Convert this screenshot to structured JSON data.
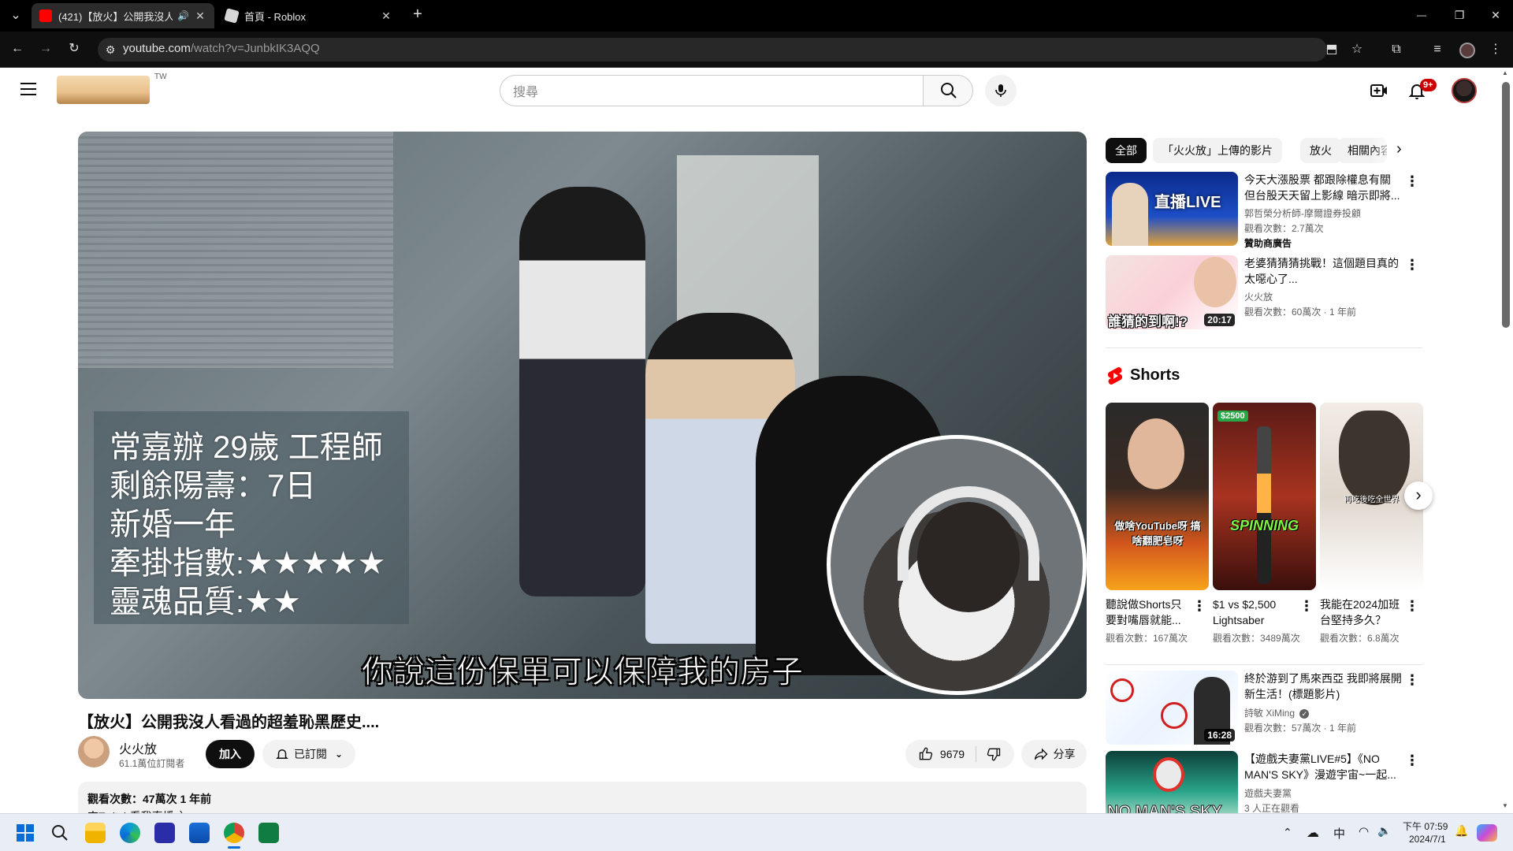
{
  "browser": {
    "tabs": [
      {
        "title": "(421)【放火】公開我沒人看過的超羞恥黑歷史....",
        "active": true
      },
      {
        "title": "首頁 - Roblox",
        "active": false
      }
    ],
    "new_tab": "+",
    "url_host": "youtube.com",
    "url_path": "/watch?v=JunbkIK3AQQ",
    "window_controls": [
      "—",
      "❐",
      "✕"
    ]
  },
  "yt": {
    "region": "TW",
    "search_placeholder": "搜尋",
    "notifications_badge": "9+"
  },
  "video": {
    "overlay_lines": [
      "常嘉辦  29歲  工程師",
      "剩餘陽壽：7日",
      "新婚一年",
      "牽掛指數:★★★★★",
      "靈魂品質:★★"
    ],
    "subtitle": "你說這份保單可以保障我的房子",
    "title": "【放火】公開我沒人看過的超羞恥黑歷史....",
    "channel": "火火放",
    "subscribers": "61.1萬位訂閱者",
    "join": "加入",
    "subscribed": "已訂閱",
    "likes": "9679",
    "share": "分享",
    "desc_line1": "觀看次數：47萬次  1 年前",
    "desc_line2": "來Twitch看我直播：）"
  },
  "sidebar": {
    "chips": [
      "全部",
      "「火火放」上傳的影片",
      "放火",
      "相關內容"
    ],
    "recs": [
      {
        "title": "今天大漲股票 都跟除權息有關 但台股天天留上影線 暗示即將...",
        "channel": "郭哲榮分析師-摩爾證券投顧",
        "meta": "觀看次數：2.7萬次",
        "badge": "贊助商廣告",
        "duration": "",
        "thumb_text": "直播LIVE"
      },
      {
        "title": "老婆猜猜猜挑戰！這個題目真的太噁心了...",
        "channel": "火火放",
        "meta": "觀看次數：60萬次 · 1 年前",
        "duration": "20:17",
        "thumb_text": "誰猜的到啊!?"
      }
    ],
    "shorts_heading": "Shorts",
    "shorts": [
      {
        "title": "聽說做Shorts只要對嘴唇就能...",
        "meta": "觀看次數：167萬次",
        "thumb_text": "做啥YouTube呀 搞啥翻肥皂呀"
      },
      {
        "title": "$1 vs $2,500 Lightsaber",
        "meta": "觀看次數：3489萬次",
        "thumb_text": "SPINNING",
        "price": "$2500"
      },
      {
        "title": "我能在2024加班台堅持多久？",
        "meta": "觀看次數：6.8萬次",
        "thumb_text": "再吃後吃全世界"
      }
    ],
    "recs2": [
      {
        "title": "終於游到了馬來西亞 我即將展開新生活！(標題影片)",
        "channel": "詩敏 XiMing",
        "meta": "觀看次數：57萬次 · 1 年前",
        "duration": "16:28"
      },
      {
        "title": "【遊戲夫妻黨LIVE#5】《NO MAN'S SKY》漫遊宇宙~一起...",
        "channel": "遊戲夫妻黨",
        "meta": "3 人正在觀看",
        "duration": "",
        "thumb_text": "NO MAN'S SKY"
      }
    ]
  },
  "taskbar": {
    "time": "下午 07:59",
    "date": "2024/7/1",
    "ime": "中"
  }
}
